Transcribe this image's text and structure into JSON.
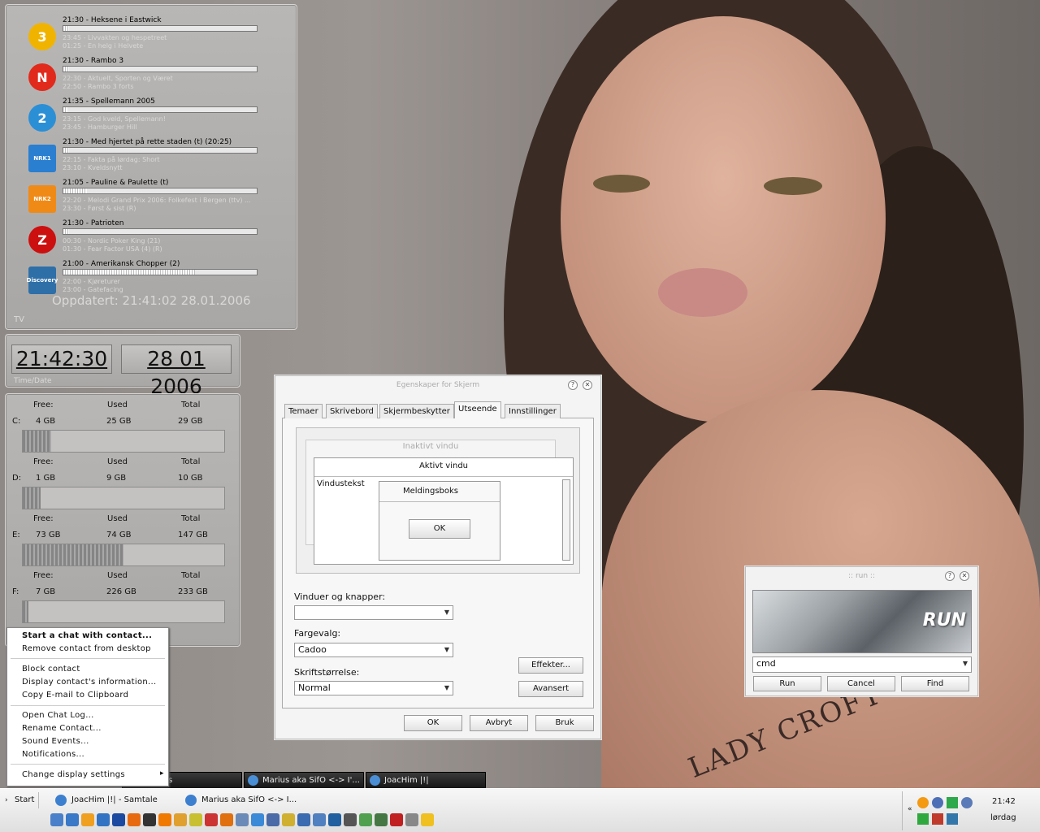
{
  "tv": {
    "rows": [
      {
        "channel": "3",
        "color": "#f0b400",
        "title": "21:30 - Heksene i Eastwick",
        "progress": 0.03,
        "sub1": "23:45 - Livvakten og hespetreet",
        "sub2": "01:25 - En helg i Helvete"
      },
      {
        "channel": "N",
        "color": "#e12a1c",
        "title": "21:30 - Rambo 3",
        "progress": 0.03,
        "sub1": "22:30 - Aktuelt, Sporten og Været",
        "sub2": "22:50 - Rambo 3 forts"
      },
      {
        "channel": "2",
        "color": "#2b8fd6",
        "title": "21:35 - Spellemann 2005",
        "progress": 0.02,
        "sub1": "23:15 - God kveld, Spellemann!",
        "sub2": "23:45 - Hamburger Hill"
      },
      {
        "channel": "NRK1",
        "color": "#2a7fd0",
        "title": "21:30 - Med hjertet på rette staden (t) (20:25)",
        "progress": 0.03,
        "sub1": "22:15 - Fakta på lørdag: Short",
        "sub2": "23:10 - Kveldsnytt"
      },
      {
        "channel": "NRK2",
        "color": "#f08a16",
        "title": "21:05 - Pauline & Paulette (t)",
        "progress": 0.12,
        "sub1": "22:20 - Melodi Grand Prix 2006: Folkefest i Bergen (ttv) ...",
        "sub2": "23:30 - Først & sist (R)"
      },
      {
        "channel": "Z",
        "color": "#cc1010",
        "title": "21:30 - Patrioten",
        "progress": 0.03,
        "sub1": "00:30 - Nordic Poker King (21)",
        "sub2": "01:30 - Fear Factor USA (4) (R)"
      },
      {
        "channel": "Discovery",
        "color": "#2f6fa8",
        "title": "21:00 - Amerikansk Chopper (2)",
        "progress": 0.68,
        "sub1": "22:00 - Kjøreturer",
        "sub2": "23:00 - Gatefacing"
      }
    ],
    "updated": "Oppdatert: 21:41:02 28.01.2006",
    "label": "TV"
  },
  "clock": {
    "time": "21:42:30",
    "date": "28 01 2006",
    "label": "Time/Date"
  },
  "drives": [
    {
      "letter": "C:",
      "free": "4 GB",
      "used": "25 GB",
      "total": "29 GB",
      "usage": 0.14
    },
    {
      "letter": "D:",
      "free": "1 GB",
      "used": "9 GB",
      "total": "10 GB",
      "usage": 0.09
    },
    {
      "letter": "E:",
      "free": "73 GB",
      "used": "74 GB",
      "total": "147 GB",
      "usage": 0.5
    },
    {
      "letter": "F:",
      "free": "7 GB",
      "used": "226 GB",
      "total": "233 GB",
      "usage": 0.03
    }
  ],
  "drive_headers": {
    "free": "Free:",
    "used": "Used",
    "total": "Total"
  },
  "display_dialog": {
    "title": "Egenskaper for Skjerm",
    "tabs": [
      "Temaer",
      "Skrivebord",
      "Skjermbeskytter",
      "Utseende",
      "Innstillinger"
    ],
    "preview": {
      "inactive": "Inaktivt vindu",
      "active": "Aktivt vindu",
      "window_text": "Vindustekst",
      "msgbox": "Meldingsboks",
      "ok": "OK"
    },
    "windows_label": "Vinduer og knapper:",
    "windows_value": "",
    "color_label": "Fargevalg:",
    "color_value": "Cadoo",
    "font_label": "Skriftstørrelse:",
    "font_value": "Normal",
    "effects": "Effekter...",
    "advanced": "Avansert",
    "ok": "OK",
    "cancel": "Avbryt",
    "apply": "Bruk"
  },
  "run_dialog": {
    "title": ":: run ::",
    "banner": "RUN",
    "value": "cmd",
    "run": "Run",
    "cancel": "Cancel",
    "find": "Find"
  },
  "context_menu": {
    "items": [
      "Start a chat with contact...",
      "Remove contact from desktop",
      "Block contact",
      "Display contact's information...",
      "Copy E-mail to Clipboard",
      "Open Chat Log...",
      "Rename Contact...",
      "Sound Events...",
      "Notifications...",
      "Change display settings"
    ]
  },
  "wallpaper_text": "LADY CROFT",
  "upper_tasks": [
    "s",
    "Marius aka SifO <-> I'...",
    "JoacHim |!|"
  ],
  "taskbar": {
    "start": "Start",
    "tasks": [
      "JoacHim |!| - Samtale",
      "Marius aka SifO <-> I..."
    ],
    "time": "21:42",
    "day": "lørdag"
  },
  "colors": {
    "panel": "#b2b0ae",
    "taskbar": "#ececec",
    "dark_task": "#1e1e1e"
  }
}
